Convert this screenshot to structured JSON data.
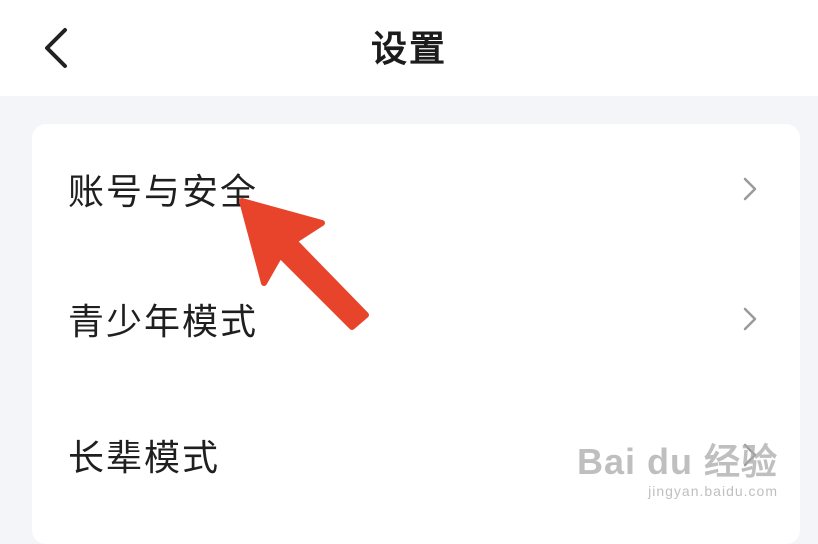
{
  "header": {
    "title": "设置",
    "back_icon": "chevron-left-icon"
  },
  "settings": {
    "items": [
      {
        "label": "账号与安全",
        "icon": "chevron-right-icon"
      },
      {
        "label": "青少年模式",
        "icon": "chevron-right-icon"
      },
      {
        "label": "长辈模式",
        "icon": "chevron-right-icon"
      }
    ]
  },
  "annotation": {
    "color": "#e8442c",
    "icon": "red-pointer-arrow"
  },
  "watermark": {
    "logo": "Bai du 经验",
    "url": "jingyan.baidu.com"
  }
}
